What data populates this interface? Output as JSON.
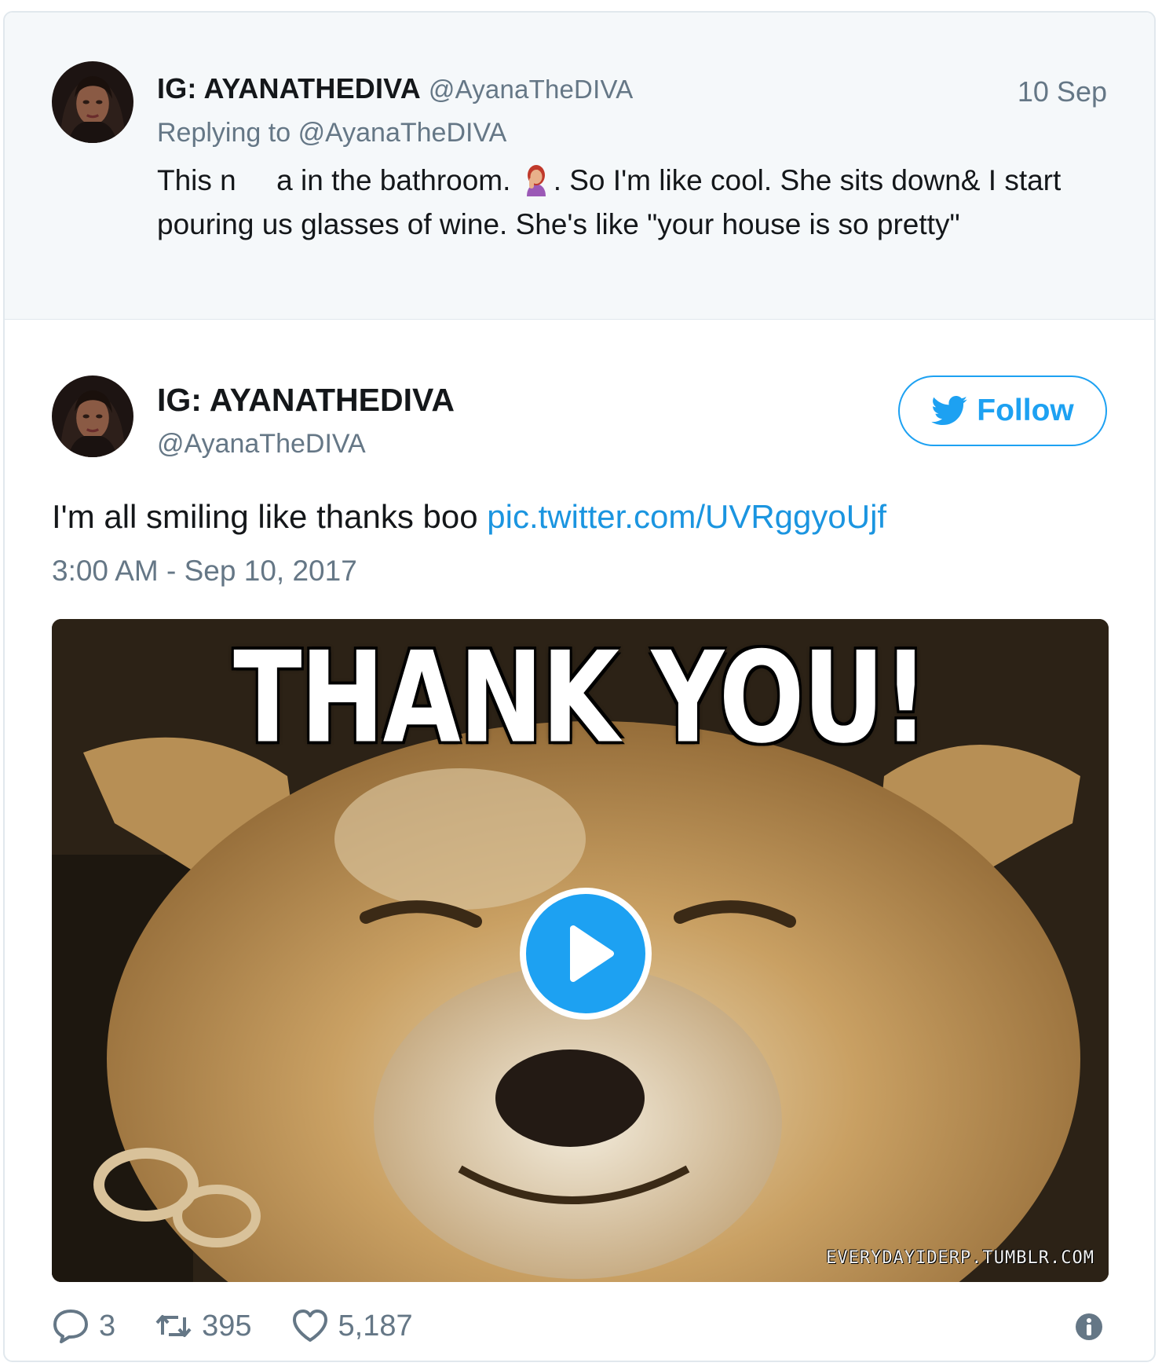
{
  "parent_tweet": {
    "display_name": "IG: AYANATHEDIVA",
    "handle": "@AyanaTheDIVA",
    "time": "10 Sep",
    "reply_prefix": "Replying to",
    "reply_handle": "@AyanaTheDIVA",
    "text_part1": "This n     a in the bathroom. ",
    "text_part2": ". So I'm like cool. She sits down& I start pouring us glasses of wine. She's like \"your house is so pretty\"",
    "emoji": "woman-facepalming-icon"
  },
  "main_tweet": {
    "display_name": "IG: AYANATHEDIVA",
    "handle": "@AyanaTheDIVA",
    "follow_label": "Follow",
    "text": "I'm all smiling like thanks boo ",
    "link": "pic.twitter.com/UVRggyoUjf",
    "date": "3:00 AM - Sep 10, 2017",
    "media": {
      "caption": "THANK YOU!",
      "watermark": "EVERYDAYIDERP.TUMBLR.COM",
      "play_icon": "play-icon"
    },
    "actions": {
      "replies": "3",
      "retweets": "395",
      "likes": "5,187"
    }
  },
  "colors": {
    "accent": "#1da1f2",
    "link": "#1b95e0",
    "muted": "#657786",
    "text": "#14171a",
    "parent_bg": "#f5f8fa"
  }
}
